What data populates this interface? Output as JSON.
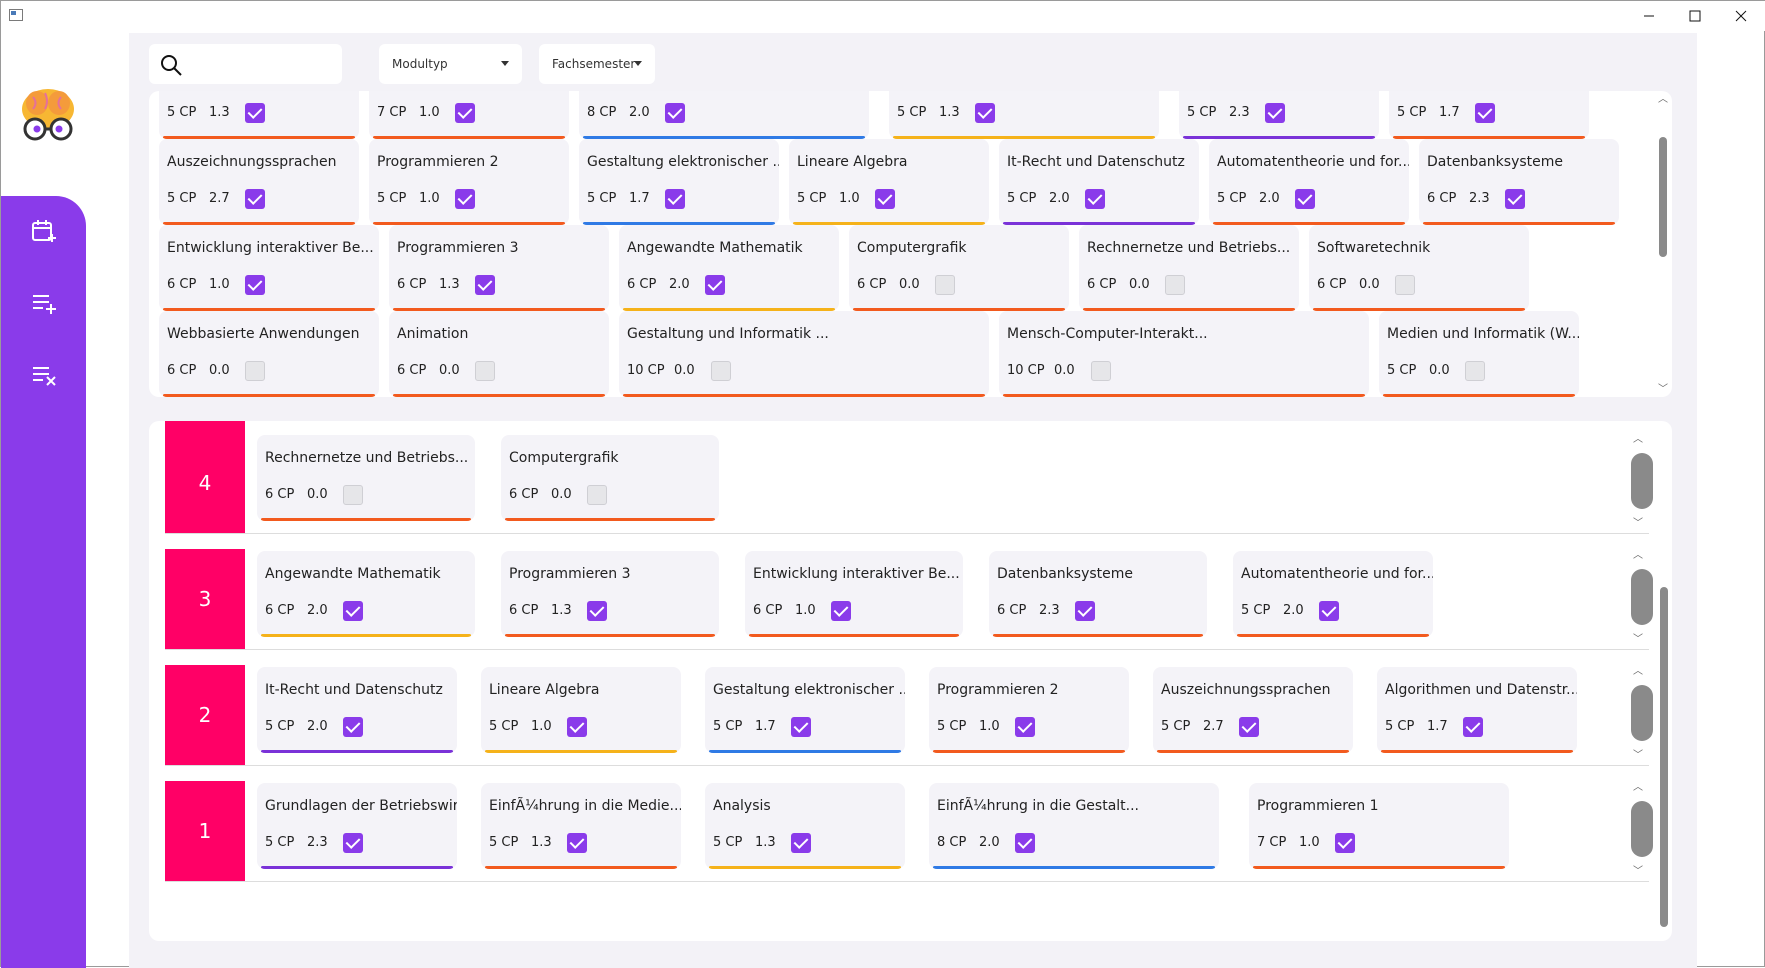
{
  "window": {
    "minimize": "—",
    "maximize": "☐",
    "close": "✕"
  },
  "filters": {
    "modultyp": "Modultyp",
    "fachsemester": "Fachsemester"
  },
  "colors": {
    "accent": "#8a3bea",
    "semester": "#ff0066",
    "orange": "#f25a1e",
    "blue": "#2f7ae5",
    "yellow": "#f5b21a",
    "purple": "#7a32d8"
  },
  "pool": {
    "row0": [
      {
        "name": "",
        "cp": "5 CP",
        "grade": "1.3",
        "checked": true,
        "color": "orange"
      },
      {
        "name": "",
        "cp": "7 CP",
        "grade": "1.0",
        "checked": true,
        "color": "orange"
      },
      {
        "name": "",
        "cp": "8 CP",
        "grade": "2.0",
        "checked": true,
        "color": "blue"
      },
      {
        "name": "",
        "cp": "5 CP",
        "grade": "1.3",
        "checked": true,
        "color": "yellow"
      },
      {
        "name": "",
        "cp": "5 CP",
        "grade": "2.3",
        "checked": true,
        "color": "purple"
      },
      {
        "name": "",
        "cp": "5 CP",
        "grade": "1.7",
        "checked": true,
        "color": "orange"
      }
    ],
    "row1": [
      {
        "name": "Auszeichnungssprachen",
        "cp": "5 CP",
        "grade": "2.7",
        "checked": true,
        "color": "orange"
      },
      {
        "name": "Programmieren 2",
        "cp": "5 CP",
        "grade": "1.0",
        "checked": true,
        "color": "orange"
      },
      {
        "name": "Gestaltung elektronischer ...",
        "cp": "5 CP",
        "grade": "1.7",
        "checked": true,
        "color": "blue"
      },
      {
        "name": "Lineare Algebra",
        "cp": "5 CP",
        "grade": "1.0",
        "checked": true,
        "color": "yellow"
      },
      {
        "name": "It-Recht und Datenschutz",
        "cp": "5 CP",
        "grade": "2.0",
        "checked": true,
        "color": "purple"
      },
      {
        "name": "Automatentheorie und for...",
        "cp": "5 CP",
        "grade": "2.0",
        "checked": true,
        "color": "orange"
      },
      {
        "name": "Datenbanksysteme",
        "cp": "6 CP",
        "grade": "2.3",
        "checked": true,
        "color": "orange"
      }
    ],
    "row2": [
      {
        "name": "Entwicklung interaktiver Be...",
        "cp": "6 CP",
        "grade": "1.0",
        "checked": true,
        "color": "orange"
      },
      {
        "name": "Programmieren 3",
        "cp": "6 CP",
        "grade": "1.3",
        "checked": true,
        "color": "orange"
      },
      {
        "name": "Angewandte Mathematik",
        "cp": "6 CP",
        "grade": "2.0",
        "checked": true,
        "color": "yellow"
      },
      {
        "name": "Computergrafik",
        "cp": "6 CP",
        "grade": "0.0",
        "checked": false,
        "color": "orange"
      },
      {
        "name": "Rechnernetze und Betriebs...",
        "cp": "6 CP",
        "grade": "0.0",
        "checked": false,
        "color": "orange"
      },
      {
        "name": "Softwaretechnik",
        "cp": "6 CP",
        "grade": "0.0",
        "checked": false,
        "color": "orange"
      }
    ],
    "row3": [
      {
        "name": "Webbasierte Anwendungen",
        "cp": "6 CP",
        "grade": "0.0",
        "checked": false,
        "color": "orange"
      },
      {
        "name": "Animation",
        "cp": "6 CP",
        "grade": "0.0",
        "checked": false,
        "color": "orange"
      },
      {
        "name": "Gestaltung und Informatik ...",
        "cp": "10 CP",
        "grade": "0.0",
        "checked": false,
        "color": "orange"
      },
      {
        "name": "Mensch-Computer-Interakt...",
        "cp": "10 CP",
        "grade": "0.0",
        "checked": false,
        "color": "orange"
      },
      {
        "name": "Medien und Informatik (W...",
        "cp": "5 CP",
        "grade": "0.0",
        "checked": false,
        "color": "orange"
      }
    ]
  },
  "semesters": [
    {
      "number": "4",
      "modules": [
        {
          "name": "Rechnernetze und Betriebs...",
          "cp": "6 CP",
          "grade": "0.0",
          "checked": false,
          "color": "orange"
        },
        {
          "name": "Computergrafik",
          "cp": "6 CP",
          "grade": "0.0",
          "checked": false,
          "color": "orange"
        }
      ]
    },
    {
      "number": "3",
      "modules": [
        {
          "name": "Angewandte Mathematik",
          "cp": "6 CP",
          "grade": "2.0",
          "checked": true,
          "color": "yellow"
        },
        {
          "name": "Programmieren 3",
          "cp": "6 CP",
          "grade": "1.3",
          "checked": true,
          "color": "orange"
        },
        {
          "name": "Entwicklung interaktiver Be...",
          "cp": "6 CP",
          "grade": "1.0",
          "checked": true,
          "color": "orange"
        },
        {
          "name": "Datenbanksysteme",
          "cp": "6 CP",
          "grade": "2.3",
          "checked": true,
          "color": "orange"
        },
        {
          "name": "Automatentheorie und for...",
          "cp": "5 CP",
          "grade": "2.0",
          "checked": true,
          "color": "orange"
        }
      ]
    },
    {
      "number": "2",
      "modules": [
        {
          "name": "It-Recht und Datenschutz",
          "cp": "5 CP",
          "grade": "2.0",
          "checked": true,
          "color": "purple"
        },
        {
          "name": "Lineare Algebra",
          "cp": "5 CP",
          "grade": "1.0",
          "checked": true,
          "color": "yellow"
        },
        {
          "name": "Gestaltung elektronischer ...",
          "cp": "5 CP",
          "grade": "1.7",
          "checked": true,
          "color": "blue"
        },
        {
          "name": "Programmieren 2",
          "cp": "5 CP",
          "grade": "1.0",
          "checked": true,
          "color": "orange"
        },
        {
          "name": "Auszeichnungssprachen",
          "cp": "5 CP",
          "grade": "2.7",
          "checked": true,
          "color": "orange"
        },
        {
          "name": "Algorithmen und Datenstr...",
          "cp": "5 CP",
          "grade": "1.7",
          "checked": true,
          "color": "orange"
        }
      ]
    },
    {
      "number": "1",
      "modules": [
        {
          "name": "Grundlagen der Betriebswir...",
          "cp": "5 CP",
          "grade": "2.3",
          "checked": true,
          "color": "purple"
        },
        {
          "name": "EinfÃ¼hrung in die Medie...",
          "cp": "5 CP",
          "grade": "1.3",
          "checked": true,
          "color": "orange"
        },
        {
          "name": "Analysis",
          "cp": "5 CP",
          "grade": "1.3",
          "checked": true,
          "color": "yellow"
        },
        {
          "name": "EinfÃ¼hrung in die Gestalt...",
          "cp": "8 CP",
          "grade": "2.0",
          "checked": true,
          "color": "blue"
        },
        {
          "name": "Programmieren 1",
          "cp": "7 CP",
          "grade": "1.0",
          "checked": true,
          "color": "orange"
        }
      ]
    }
  ]
}
